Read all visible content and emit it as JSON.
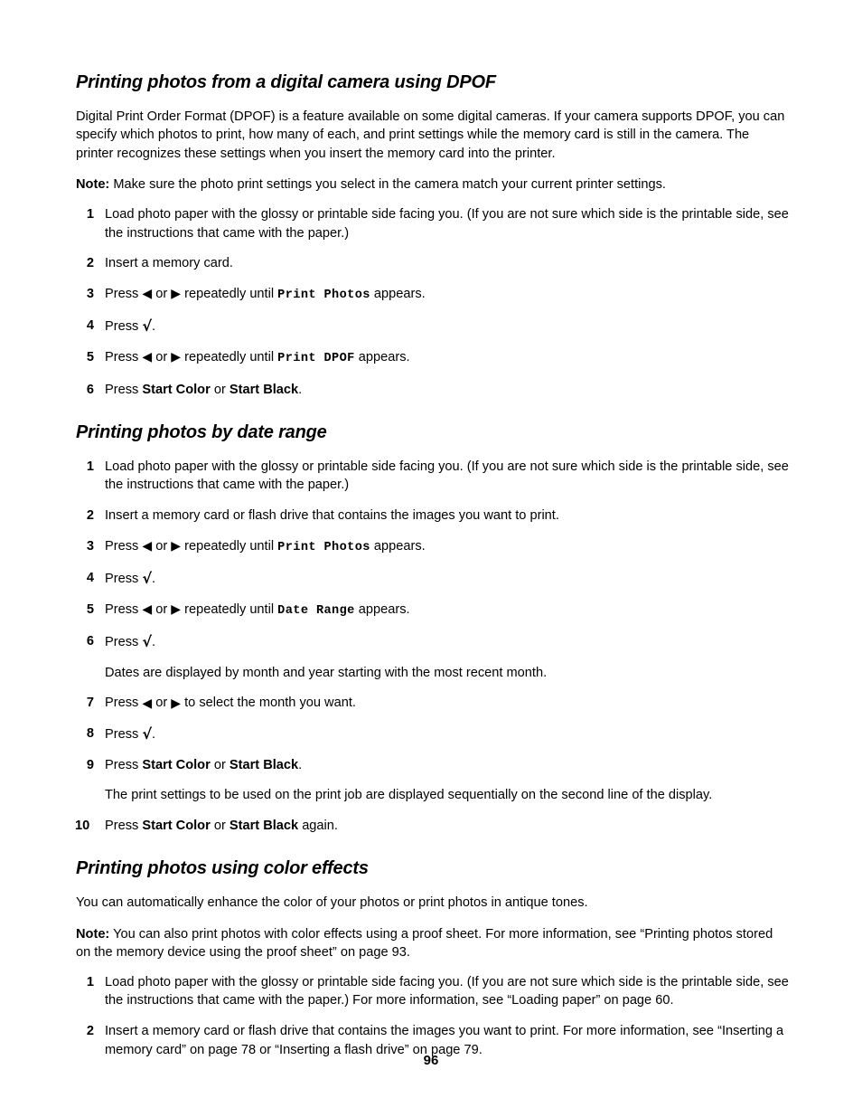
{
  "page": {
    "number": "96"
  },
  "glyphs": {
    "left_arrow": "◀",
    "right_arrow": "▶",
    "check": "√",
    "or": "or",
    "period": ".",
    "space": " "
  },
  "sections": [
    {
      "heading": "Printing photos from a digital camera using DPOF",
      "intro": "Digital Print Order Format (DPOF) is a feature available on some digital cameras. If your camera supports DPOF, you can specify which photos to print, how many of each, and print settings while the memory card is still in the camera. The printer recognizes these settings when you insert the memory card into the printer.",
      "note_label": "Note:",
      "note_text": "Make sure the photo print settings you select in the camera match your current printer settings.",
      "steps": [
        {
          "num": "1",
          "text": "Load photo paper with the glossy or printable side facing you. (If you are not sure which side is the printable side, see the instructions that came with the paper.)"
        },
        {
          "num": "2",
          "text": "Insert a memory card."
        },
        {
          "num": "3",
          "press": "Press",
          "mid": "repeatedly until",
          "display": "Print Photos",
          "tail": "appears."
        },
        {
          "num": "4",
          "press": "Press"
        },
        {
          "num": "5",
          "press": "Press",
          "mid": "repeatedly until",
          "display": "Print DPOF",
          "tail": "appears."
        },
        {
          "num": "6",
          "press": "Press",
          "button_a": "Start Color",
          "between": "or",
          "button_b": "Start Black",
          "tail": "."
        }
      ]
    },
    {
      "heading": "Printing photos by date range",
      "steps": [
        {
          "num": "1",
          "text": "Load photo paper with the glossy or printable side facing you. (If you are not sure which side is the printable side, see the instructions that came with the paper.)"
        },
        {
          "num": "2",
          "text": "Insert a memory card or flash drive that contains the images you want to print."
        },
        {
          "num": "3",
          "press": "Press",
          "mid": "repeatedly until",
          "display": "Print Photos",
          "tail": "appears."
        },
        {
          "num": "4",
          "press": "Press"
        },
        {
          "num": "5",
          "press": "Press",
          "mid": "repeatedly until",
          "display": "Date Range",
          "tail": "appears."
        },
        {
          "num": "6",
          "press": "Press",
          "sub": "Dates are displayed by month and year starting with the most recent month."
        },
        {
          "num": "7",
          "press": "Press",
          "mid": "to select the month you want."
        },
        {
          "num": "8",
          "press": "Press"
        },
        {
          "num": "9",
          "press": "Press",
          "button_a": "Start Color",
          "between": "or",
          "button_b": "Start Black",
          "tail": ".",
          "sub": "The print settings to be used on the print job are displayed sequentially on the second line of the display."
        },
        {
          "num": "10",
          "press": "Press",
          "button_a": "Start Color",
          "between": "or",
          "button_b": "Start Black",
          "tail": " again."
        }
      ]
    },
    {
      "heading": "Printing photos using color effects",
      "intro": "You can automatically enhance the color of your photos or print photos in antique tones.",
      "note_label": "Note:",
      "note_text": "You can also print photos with color effects using a proof sheet. For more information, see “Printing photos stored on the memory device using the proof sheet” on page 93.",
      "steps": [
        {
          "num": "1",
          "text": "Load photo paper with the glossy or printable side facing you. (If you are not sure which side is the printable side, see the instructions that came with the paper.) For more information, see “Loading paper” on page 60."
        },
        {
          "num": "2",
          "text": "Insert a memory card or flash drive that contains the images you want to print. For more information, see “Inserting a memory card” on page 78 or “Inserting a flash drive” on page 79."
        }
      ]
    }
  ]
}
